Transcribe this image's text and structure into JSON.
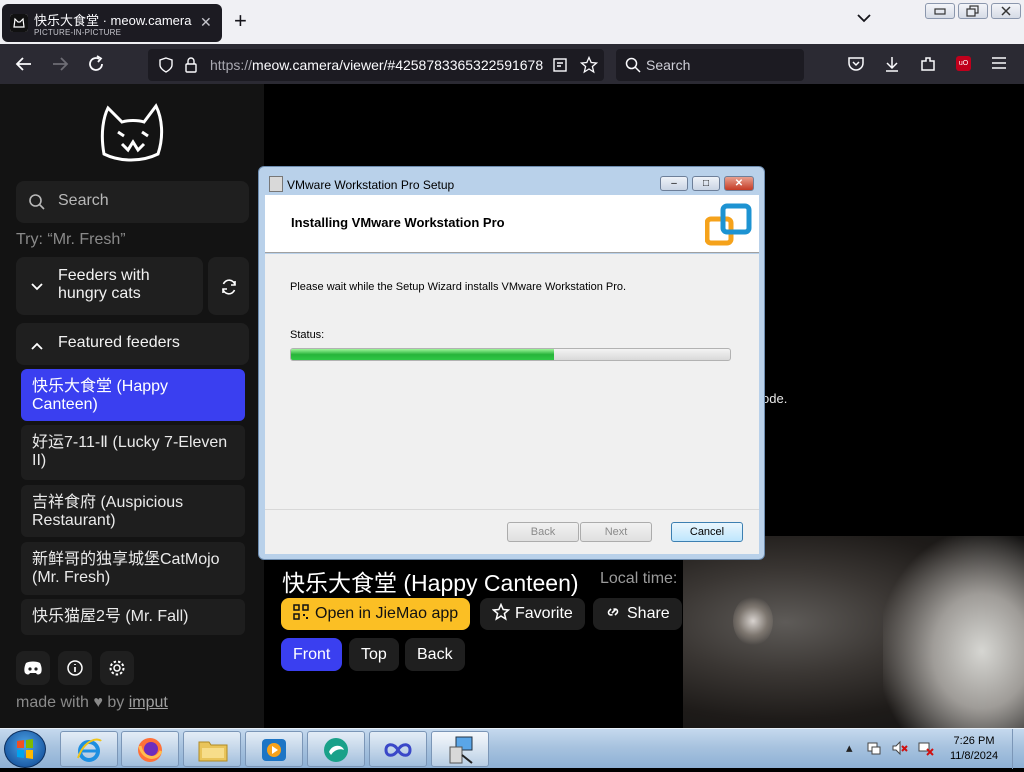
{
  "browser": {
    "tab": {
      "title": "快乐大食堂 · meow.camera",
      "subtitle": "PICTURE-IN-PICTURE"
    },
    "url": {
      "protocol": "https://",
      "rest": "meow.camera/viewer/#4258783365322591678"
    },
    "search_placeholder": "Search"
  },
  "sidebar": {
    "search_placeholder": "Search",
    "hint": "Try: “Mr. Fresh”",
    "feeders_with_hungry": "Feeders with hungry cats",
    "featured_label": "Featured feeders",
    "feeders": [
      {
        "label": "快乐大食堂 (Happy Canteen)",
        "active": true
      },
      {
        "label": "好运7-11-Ⅱ (Lucky 7-Eleven II)",
        "active": false
      },
      {
        "label": "吉祥食府 (Auspicious Restaurant)",
        "active": false
      },
      {
        "label": "新鲜哥的独享城堡CatMojo (Mr. Fresh)",
        "active": false
      },
      {
        "label": "快乐猫屋2号 (Mr. Fall)",
        "active": false
      }
    ],
    "made_with_prefix": "made with",
    "made_with_by": "by",
    "made_with_author": "imput"
  },
  "main": {
    "feed_title": "快乐大食堂 (Happy Canteen)",
    "local_time_label": "Local time:",
    "open_app": "Open in JieMao app",
    "favorite": "Favorite",
    "share": "Share",
    "views": [
      "Front",
      "Top",
      "Back"
    ],
    "partial_text": "ode."
  },
  "installer": {
    "window_title": "VMware Workstation Pro Setup",
    "heading": "Installing VMware Workstation Pro",
    "message": "Please wait while the Setup Wizard installs VMware Workstation Pro.",
    "status_label": "Status:",
    "progress_fraction": 0.6,
    "back": "Back",
    "next": "Next",
    "cancel": "Cancel"
  },
  "taskbar": {
    "time": "7:26 PM",
    "date": "11/8/2024"
  }
}
